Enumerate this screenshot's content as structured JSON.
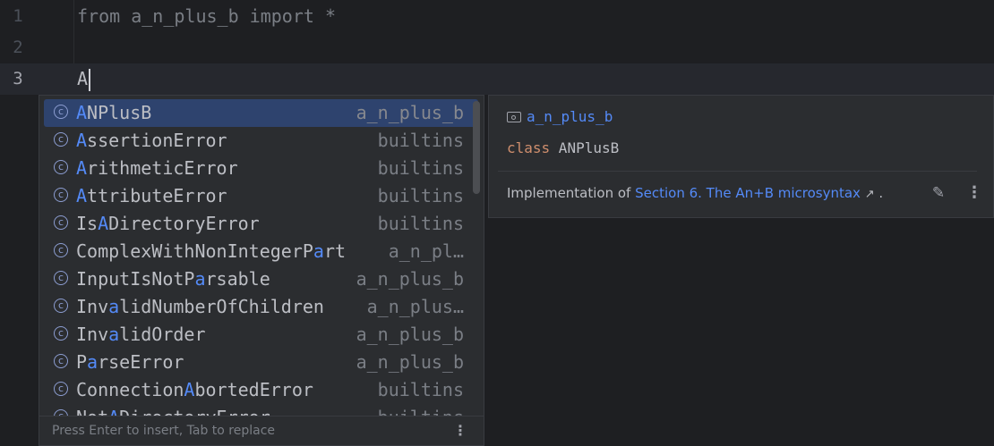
{
  "editor": {
    "lines": [
      {
        "num": "1",
        "code_kw1": "from",
        "code_mod": " a_n_plus_b ",
        "code_kw2": "import",
        "code_rest": " *"
      },
      {
        "num": "2"
      },
      {
        "num": "3",
        "typed": "A"
      }
    ]
  },
  "completion": {
    "items": [
      {
        "pre": "",
        "hl": "A",
        "post": "NPlusB",
        "module": "a_n_plus_b",
        "selected": true
      },
      {
        "pre": "",
        "hl": "A",
        "post": "ssertionError",
        "module": "builtins"
      },
      {
        "pre": "",
        "hl": "A",
        "post": "rithmeticError",
        "module": "builtins"
      },
      {
        "pre": "",
        "hl": "A",
        "post": "ttributeError",
        "module": "builtins"
      },
      {
        "pre": "Is",
        "hl": "A",
        "post": "DirectoryError",
        "module": "builtins"
      },
      {
        "pre": "ComplexWithNonIntegerP",
        "hl": "a",
        "post": "rt",
        "module": "a_n_pl…"
      },
      {
        "pre": "InputIsNotP",
        "hl": "a",
        "post": "rsable",
        "module": "a_n_plus_b"
      },
      {
        "pre": "Inv",
        "hl": "a",
        "post": "lidNumberOfChildren",
        "module": "a_n_plus…"
      },
      {
        "pre": "Inv",
        "hl": "a",
        "post": "lidOrder",
        "module": "a_n_plus_b"
      },
      {
        "pre": "P",
        "hl": "a",
        "post": "rseError",
        "module": "a_n_plus_b"
      },
      {
        "pre": "Connection",
        "hl": "A",
        "post": "bortedError",
        "module": "builtins"
      },
      {
        "pre": "Not",
        "hl": "A",
        "post": "DirectoryError",
        "module": "builtins"
      }
    ],
    "footer_hint": "Press Enter to insert, Tab to replace",
    "more_label": "⋮"
  },
  "doc": {
    "module": "a_n_plus_b",
    "signature_kw": "class",
    "signature_name": " ANPlusB",
    "desc_prefix": "Implementation of ",
    "desc_link": "Section 6. The An+B microsyntax",
    "desc_link_icon": "↗",
    "desc_suffix": " .",
    "edit_icon": "✎",
    "menu_icon": "⋮"
  },
  "colors": {
    "background": "#1e1f22",
    "popup": "#2b2d30",
    "selection": "#2e436e",
    "match_highlight": "#548af7",
    "keyword": "#cf8e6d"
  }
}
